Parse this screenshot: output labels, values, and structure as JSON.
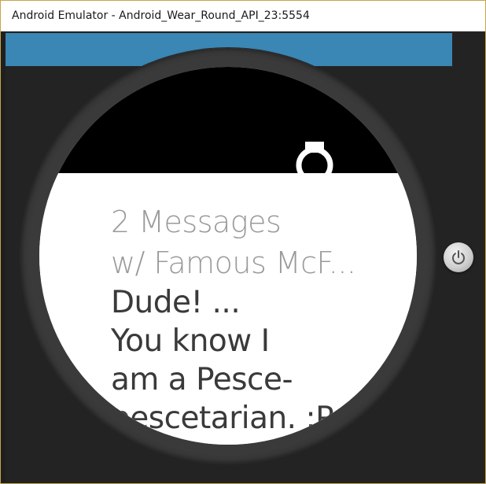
{
  "window": {
    "title": "Android Emulator - Android_Wear_Round_API_23:5554"
  },
  "watch": {
    "notification": {
      "title_lines": [
        "2 Messages",
        "w/ Famous McF..."
      ],
      "body_lines": [
        "Dude! ...",
        "You know I",
        "am a Pesce-",
        "pescetarian. :P"
      ]
    },
    "icons": {
      "card_peek": "watch-icon",
      "power": "power-icon"
    }
  },
  "colors": {
    "accent_strip": "#3a86b4",
    "screen_top": "#000000",
    "card_background": "#ffffff",
    "title_text": "#9a9a9a",
    "body_text": "#3a3a3a"
  }
}
